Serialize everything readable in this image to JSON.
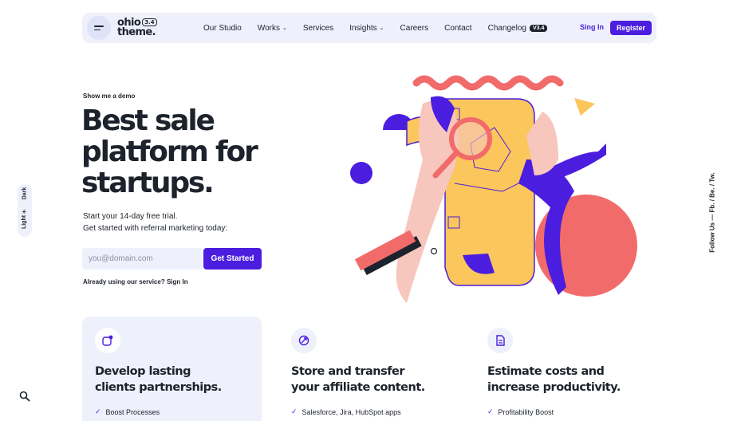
{
  "colors": {
    "accent": "#4b1ddf",
    "text": "#1d232c",
    "soft_bg": "#eef0fb",
    "coral": "#f26b6b",
    "yellow": "#fbc65c",
    "pink": "#f7c6bd"
  },
  "header": {
    "logo_line1": "ohio",
    "logo_version": "3.4",
    "logo_line2": "theme.",
    "nav": [
      {
        "label": "Our Studio",
        "caret": false
      },
      {
        "label": "Works",
        "caret": true
      },
      {
        "label": "Services",
        "caret": false
      },
      {
        "label": "Insights",
        "caret": true
      },
      {
        "label": "Careers",
        "caret": false
      },
      {
        "label": "Contact",
        "caret": false
      },
      {
        "label": "Changelog",
        "caret": false,
        "badge": "V3.4"
      }
    ],
    "signin": "Sing In",
    "register": "Register"
  },
  "hero": {
    "eyebrow": "Show me a demo",
    "title": "Best sale platform for startups.",
    "sub_line1": "Start your 14-day free trial.",
    "sub_line2": "Get started with referral marketing today:",
    "email_placeholder": "you@domain.com",
    "cta": "Get Started",
    "already_text": "Already using our service?",
    "already_link": "Sign In"
  },
  "theme_switch": {
    "light": "Light",
    "dark": "Dark",
    "sun_icon": "sun-icon"
  },
  "follow": "Follow Us — Fb. / Be. / Tw.",
  "features": [
    {
      "icon": "notification-icon",
      "title_line1": "Develop lasting",
      "title_line2": "clients partnerships.",
      "item": "Boost Processes"
    },
    {
      "icon": "sync-icon",
      "title_line1": "Store and transfer",
      "title_line2": "your affiliate content.",
      "item": "Salesforce, Jira, HubSpot apps"
    },
    {
      "icon": "document-icon",
      "title_line1": "Estimate costs and",
      "title_line2": "increase productivity.",
      "item": "Profitability Boost"
    }
  ]
}
